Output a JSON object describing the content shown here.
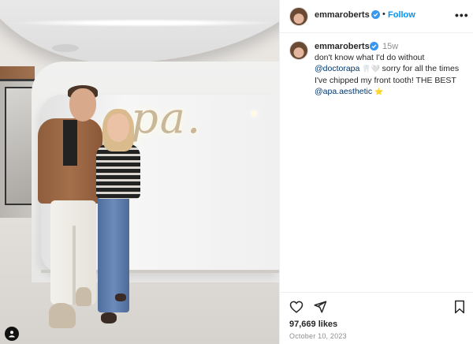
{
  "post": {
    "username": "emmaroberts",
    "follow_label": "Follow",
    "separator": "•",
    "more_label": "•••",
    "time_ago": "15w",
    "caption": {
      "part1": "don't know what I'd do without ",
      "mention1": "@doctorapa",
      "emoji1": "🦷🤍",
      "part2": " sorry for all the times I've chipped my front tooth! THE BEST ",
      "mention2": "@apa.aesthetic",
      "emoji2": "⭐"
    },
    "likes": "97,669 likes",
    "date": "October 10, 2023"
  },
  "photo": {
    "sign_text": "apa."
  },
  "icons": {
    "verified": "verified-badge-icon",
    "heart": "heart-icon",
    "share": "share-icon",
    "bookmark": "bookmark-icon",
    "tag": "user-tag-icon"
  },
  "colors": {
    "follow_blue": "#0095f6",
    "verified_blue": "#3897f0",
    "mention_blue": "#00376b",
    "secondary_text": "#8e8e8e"
  }
}
